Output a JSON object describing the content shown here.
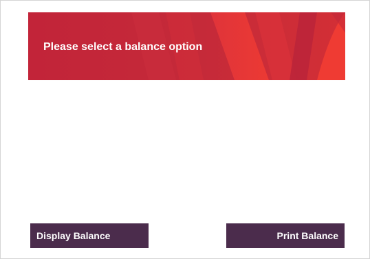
{
  "banner": {
    "title": "Please select a balance option"
  },
  "actions": {
    "left_label": "Display Balance",
    "right_label": "Print Balance"
  },
  "colors": {
    "banner_primary": "#c4263a",
    "banner_accent": "#e8333a",
    "button_bg": "#4b2c4c",
    "button_text": "#ffffff"
  }
}
